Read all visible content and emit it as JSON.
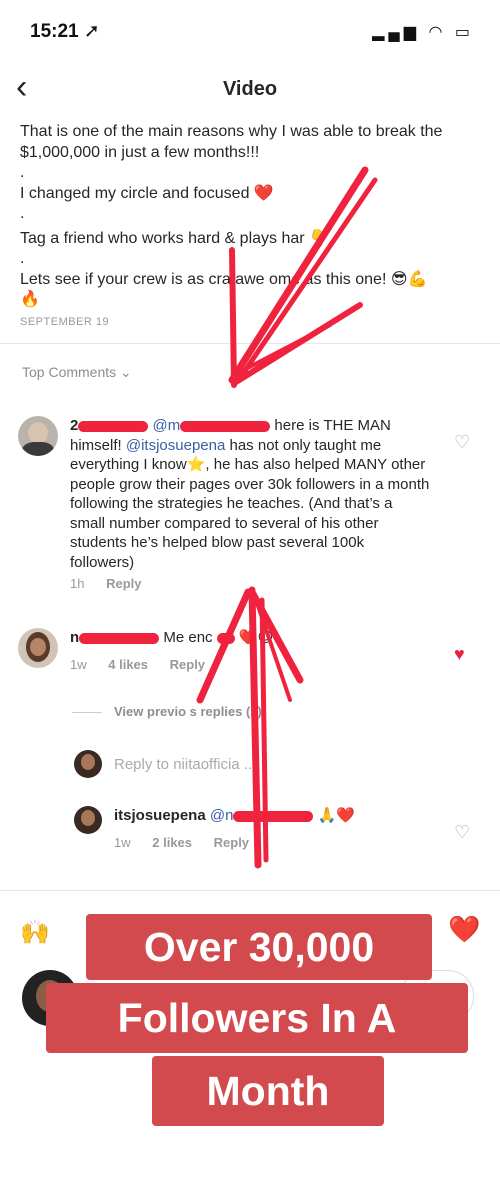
{
  "status": {
    "time": "15:21 ➚",
    "icons": "▂▄▆ ◠ ▭"
  },
  "nav": {
    "back": "‹",
    "title": "Video"
  },
  "caption": {
    "line1": "That is one of the main reasons why I was able to break the $1,000,000 in just a few months!!!",
    "dot1": ".",
    "line2": "I changed my circle and focused ❤️",
    "dot2": ".",
    "line3": "Tag a friend who works hard & plays har 👇",
    "dot3": ".",
    "line4": "Lets see if your crew is as cra awe ome as this one! 😎💪",
    "line5": "🔥",
    "date": "SEPTEMBER 19"
  },
  "top_comments": "Top Comments ⌄",
  "comment1": {
    "lead": "2",
    "mention1": "@m",
    "after": " here is THE MAN himself! ",
    "mention2": "@itsjosuepena",
    "body": " has not only taught me everything I know⭐, he has also helped MANY other people grow their pages over 30k followers in a month following the strategies he teaches. (And that’s a small number compared to several of his other students he’s helped blow past several 100k followers)",
    "time": "1h",
    "reply": "Reply"
  },
  "comment2": {
    "user": "n",
    "text": "Me enc",
    "emoji": "❤️😍",
    "time": "1w",
    "likes": "4 likes",
    "reply": "Reply"
  },
  "view_replies": "View previo s replies (2)",
  "reply_box": {
    "placeholder": "Reply to niitaofficia ..."
  },
  "comment3": {
    "user": "itsjosuepena",
    "mention": "@n",
    "emoji": "🙏❤️",
    "time": "1w",
    "likes": "2 likes",
    "reply": "Reply"
  },
  "bottom": {
    "hands": "🙌",
    "heart": "❤️"
  },
  "banner": {
    "line1": "Over 30,000",
    "line2": "Followers In A",
    "line3": "Month"
  },
  "colors": {
    "banner": "#d24a4d",
    "arrow": "#f0233f",
    "heart": "#e8223c",
    "mention": "#3b5ea6"
  }
}
